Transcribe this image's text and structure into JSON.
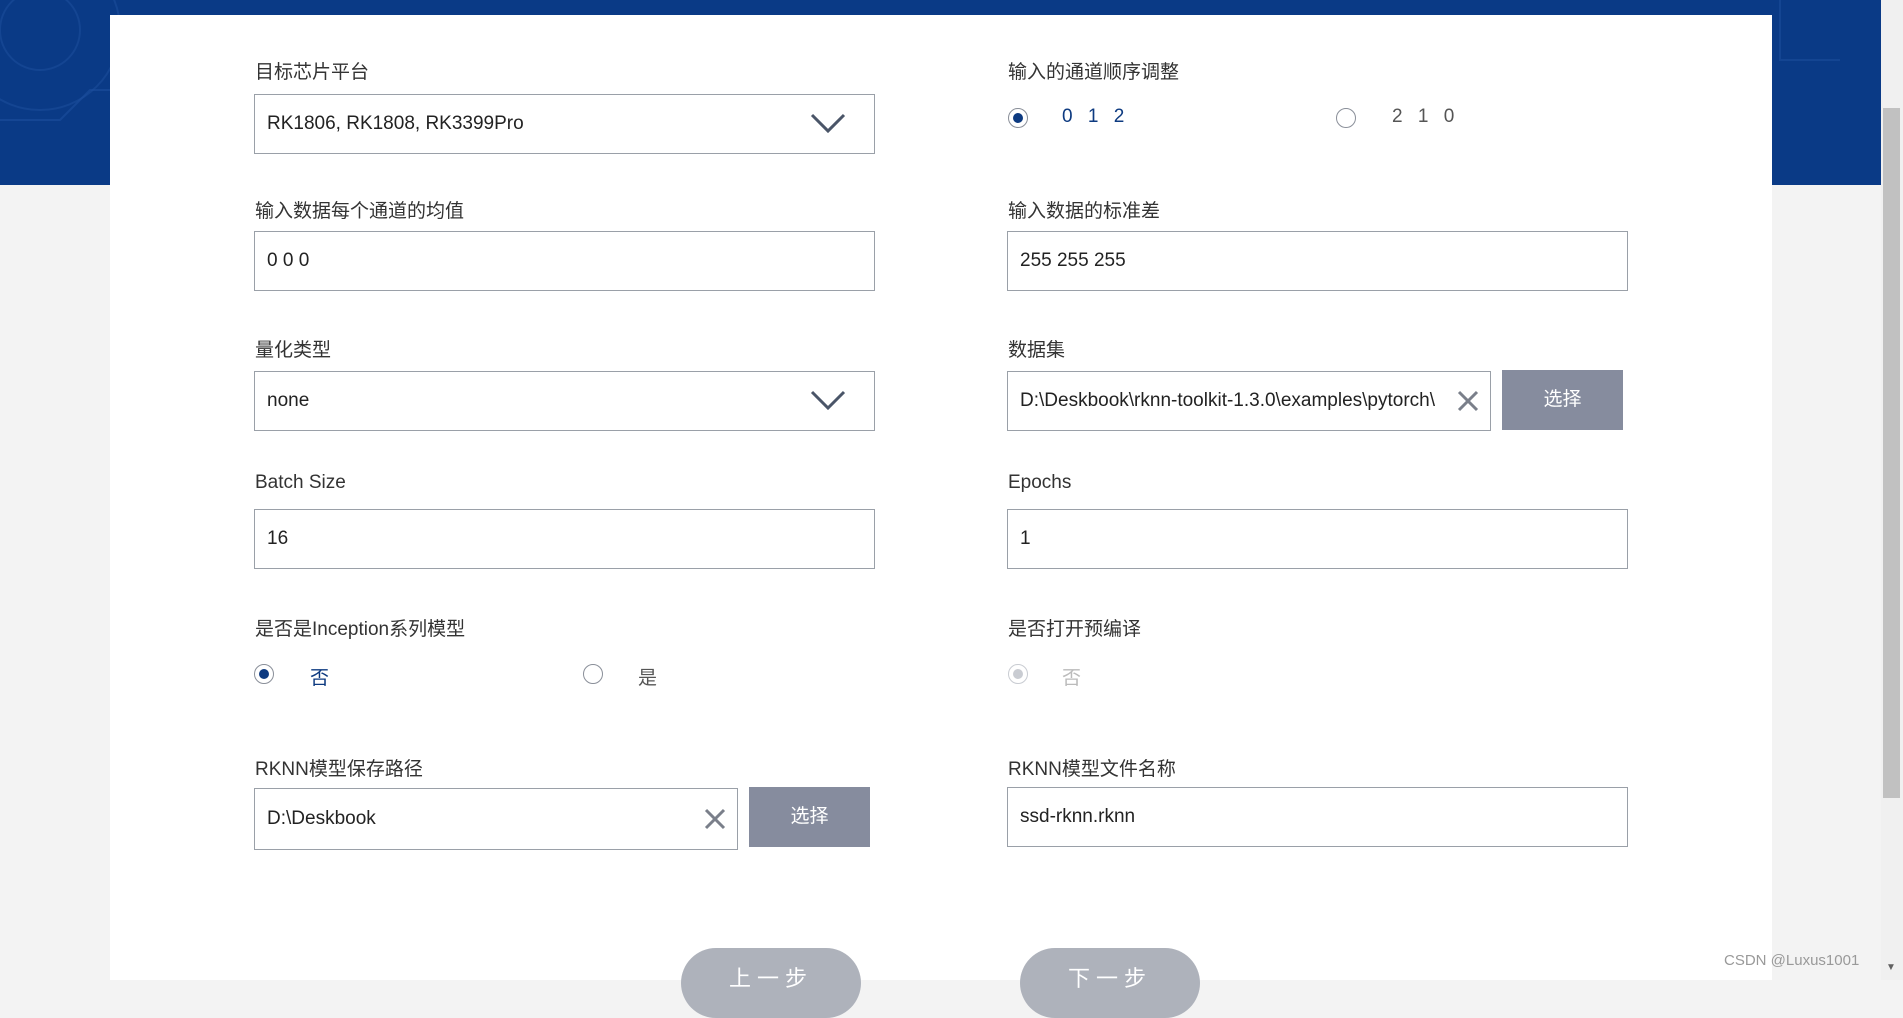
{
  "colors": {
    "banner": "#0a3a86",
    "accent": "#0d3a80",
    "button": "#868c9e"
  },
  "target_chip": {
    "label": "目标芯片平台",
    "value": "RK1806, RK1808, RK3399Pro",
    "icon": "chevron-down-icon"
  },
  "channel_order": {
    "label": "输入的通道顺序调整",
    "option_a": "0 1 2",
    "option_b": "2 1 0",
    "selected": "0 1 2"
  },
  "mean": {
    "label": "输入数据每个通道的均值",
    "value": "0 0 0"
  },
  "std": {
    "label": "输入数据的标准差",
    "value": "255 255 255"
  },
  "quant_type": {
    "label": "量化类型",
    "value": "none",
    "icon": "chevron-down-icon"
  },
  "dataset": {
    "label": "数据集",
    "value": "D:\\Deskbook\\rknn-toolkit-1.3.0\\examples\\pytorch\\",
    "button": "选择",
    "clear_icon": "close-icon"
  },
  "batch_size": {
    "label": "Batch Size",
    "value": "16"
  },
  "epochs": {
    "label": "Epochs",
    "value": "1"
  },
  "inception": {
    "label": "是否是Inception系列模型",
    "option_no": "否",
    "option_yes": "是",
    "selected": "否"
  },
  "precompile": {
    "label": "是否打开预编译",
    "option_no": "否",
    "selected": "否",
    "disabled": true
  },
  "save_path": {
    "label": "RKNN模型保存路径",
    "value": "D:\\Deskbook",
    "button": "选择",
    "clear_icon": "close-icon"
  },
  "file_name": {
    "label": "RKNN模型文件名称",
    "value": "ssd-rknn.rknn"
  },
  "nav": {
    "prev": "上一步",
    "next": "下一步"
  },
  "watermark": "CSDN @Luxus1001"
}
